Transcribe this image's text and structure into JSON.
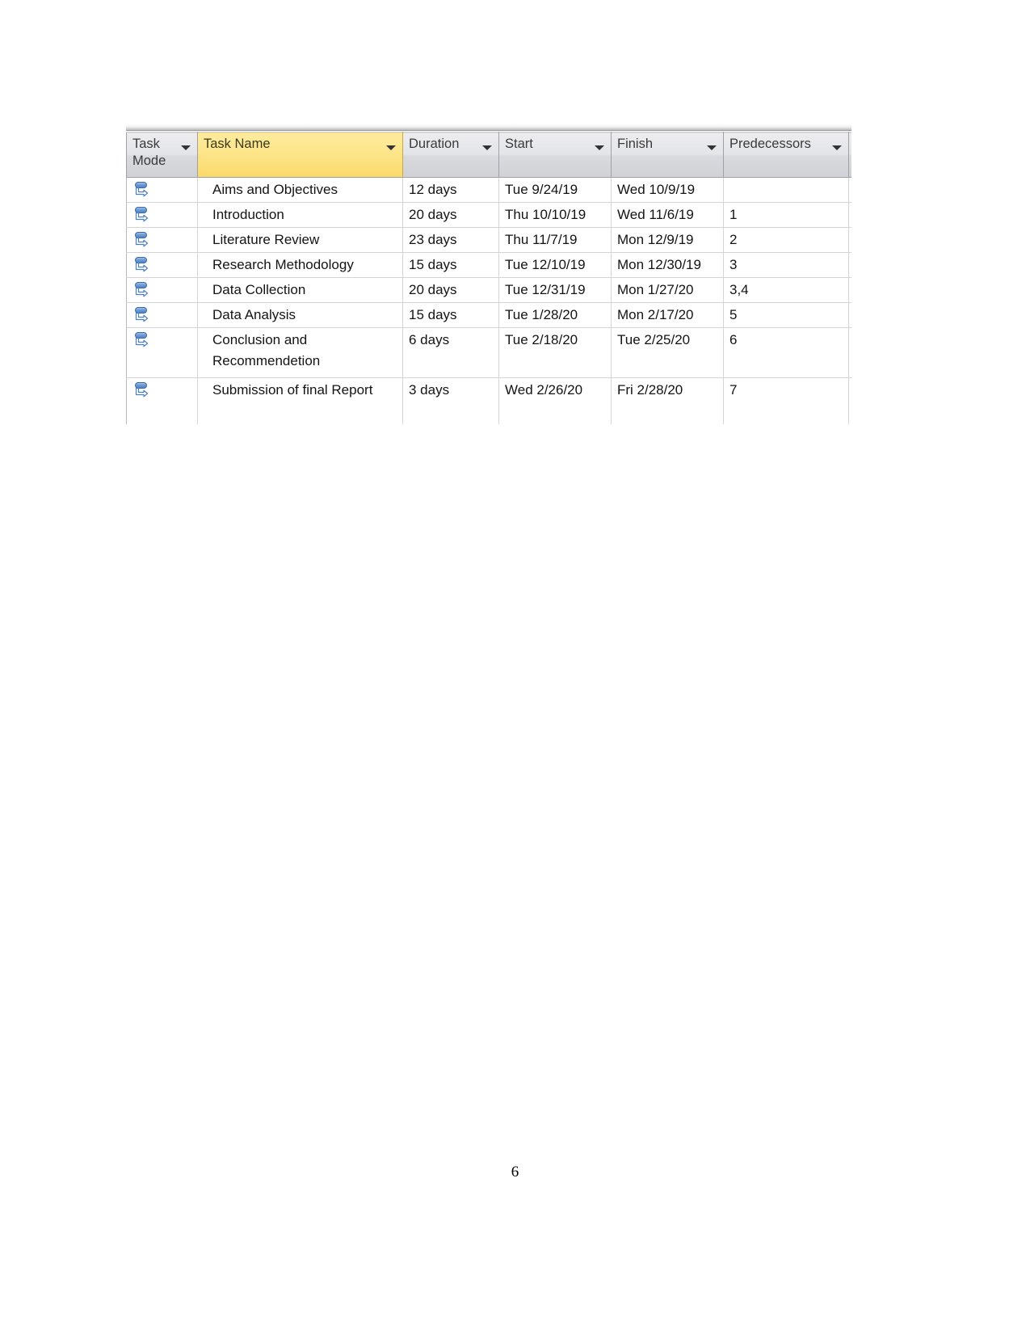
{
  "document": {
    "page_number": "6"
  },
  "table": {
    "name": "ms-project-gantt-entry-table",
    "selected_column": "Task Name",
    "accent_header_color": "#fde589",
    "header_color": "#dcdde1",
    "grid_line_color": "#d3d3d8",
    "columns": [
      {
        "key": "task_mode",
        "label": "Task Mode",
        "has_filter_arrow": true,
        "selected": false
      },
      {
        "key": "task_name",
        "label": "Task Name",
        "has_filter_arrow": true,
        "selected": true
      },
      {
        "key": "duration",
        "label": "Duration",
        "has_filter_arrow": true,
        "selected": false
      },
      {
        "key": "start",
        "label": "Start",
        "has_filter_arrow": true,
        "selected": false
      },
      {
        "key": "finish",
        "label": "Finish",
        "has_filter_arrow": true,
        "selected": false
      },
      {
        "key": "predecessors",
        "label": "Predecessors",
        "has_filter_arrow": true,
        "selected": false
      }
    ],
    "task_mode_icon": "manually-scheduled-icon",
    "rows": [
      {
        "id": "1",
        "task_mode_icon": "manually-scheduled-icon",
        "task_name": "Aims and Objectives",
        "duration": "12 days",
        "start": "Tue 9/24/19",
        "finish": "Wed 10/9/19",
        "predecessors": "",
        "tall": false
      },
      {
        "id": "2",
        "task_mode_icon": "manually-scheduled-icon",
        "task_name": "Introduction",
        "duration": "20 days",
        "start": "Thu 10/10/19",
        "finish": "Wed 11/6/19",
        "predecessors": "1",
        "tall": false
      },
      {
        "id": "3",
        "task_mode_icon": "manually-scheduled-icon",
        "task_name": "Literature Review",
        "duration": "23 days",
        "start": "Thu 11/7/19",
        "finish": "Mon 12/9/19",
        "predecessors": "2",
        "tall": false
      },
      {
        "id": "4",
        "task_mode_icon": "manually-scheduled-icon",
        "task_name": "Research Methodology",
        "duration": "15 days",
        "start": "Tue 12/10/19",
        "finish": "Mon 12/30/19",
        "predecessors": "3",
        "tall": false
      },
      {
        "id": "5",
        "task_mode_icon": "manually-scheduled-icon",
        "task_name": "Data Collection",
        "duration": "20 days",
        "start": "Tue 12/31/19",
        "finish": "Mon 1/27/20",
        "predecessors": "3,4",
        "tall": false
      },
      {
        "id": "6",
        "task_mode_icon": "manually-scheduled-icon",
        "task_name": "Data Analysis",
        "duration": "15 days",
        "start": "Tue 1/28/20",
        "finish": "Mon 2/17/20",
        "predecessors": "5",
        "tall": false
      },
      {
        "id": "7",
        "task_mode_icon": "manually-scheduled-icon",
        "task_name": "Conclusion and Recommendetion",
        "duration": "6 days",
        "start": "Tue 2/18/20",
        "finish": "Tue 2/25/20",
        "predecessors": "6",
        "tall": true
      },
      {
        "id": "8",
        "task_mode_icon": "manually-scheduled-icon",
        "task_name": "Submission of final Report",
        "duration": "3 days",
        "start": "Wed 2/26/20",
        "finish": "Fri 2/28/20",
        "predecessors": "7",
        "tall": true
      }
    ]
  }
}
